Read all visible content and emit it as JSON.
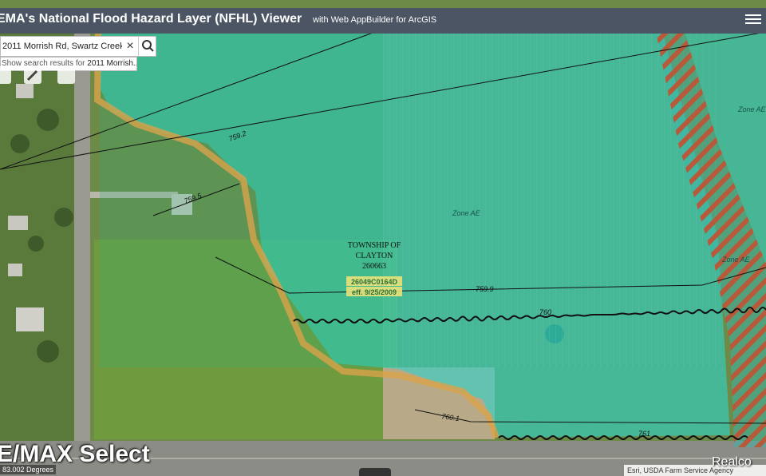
{
  "header": {
    "title": "EMA's National Flood Hazard Layer (NFHL) Viewer",
    "subtitle": "with Web AppBuilder for ArcGIS",
    "menu_icon": "hamburger-menu-icon"
  },
  "search": {
    "value": "2011 Morrish Rd, Swartz Creek,",
    "clear_icon": "close-icon",
    "search_icon": "search-icon",
    "suggestion_prefix": "Show search results for ",
    "suggestion_term": "2011 Morrish..."
  },
  "map": {
    "labels": {
      "zone_ae_center": "Zone AE",
      "zone_ae_right": "Zone AE",
      "zone_ae_top_right": "Zone AE",
      "township_line1": "TOWNSHIP OF",
      "township_line2": "CLAYTON",
      "township_code": "260663",
      "panel_id": "26049C0164D",
      "panel_eff": "eff. 9/25/2009"
    },
    "bfe_labels": [
      "759.2",
      "759.5",
      "759.9",
      "760",
      "760.1",
      "761"
    ],
    "colors": {
      "flood_zone": "#2fd4c8",
      "floodway_hatch": "#b85a3a",
      "boundary": "#d9a24a"
    }
  },
  "watermark": "E/MAX Select",
  "scale_text": "83.002 Degrees",
  "attribution": "Esri, USDA Farm Service Agency",
  "realcomp": "Realco"
}
